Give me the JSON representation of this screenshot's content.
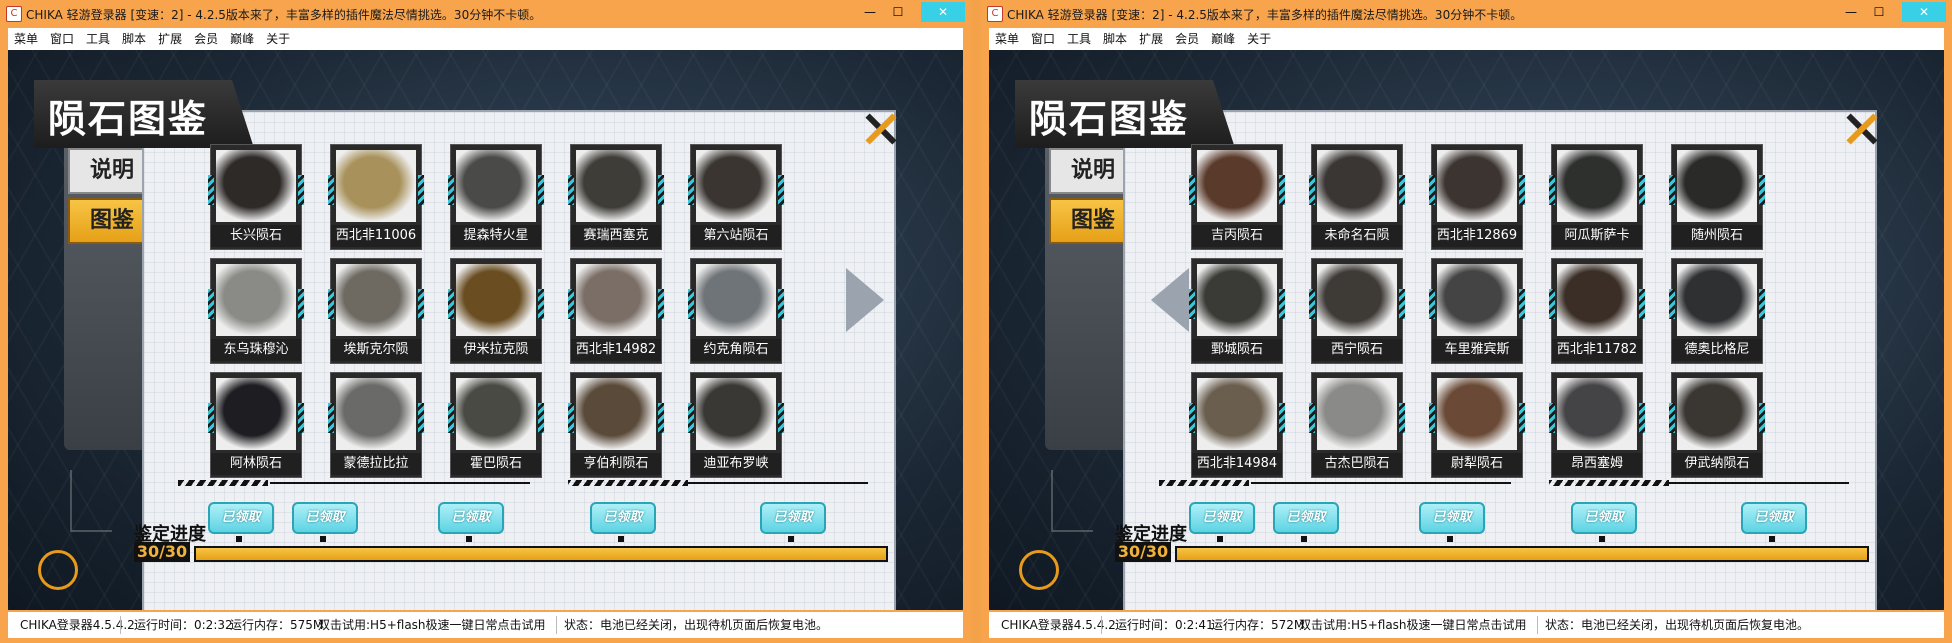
{
  "windows": [
    {
      "title": "CHIKA 轻游登录器 [变速：2] - 4.2.5版本来了，丰富多样的插件魔法尽情挑选。30分钟不卡顿。",
      "menu": [
        "菜单",
        "窗口",
        "工具",
        "脚本",
        "扩展",
        "会员",
        "巅峰",
        "关于"
      ],
      "game": {
        "heading": "陨石图鉴",
        "tabs": [
          "说明",
          "图鉴"
        ],
        "meteorites": [
          {
            "name": "长兴陨石",
            "color": "#2e2a28"
          },
          {
            "name": "西北非11006",
            "color": "#a8915a"
          },
          {
            "name": "提森特火星",
            "color": "#4a4a48"
          },
          {
            "name": "赛瑞西塞克",
            "color": "#3e3d38"
          },
          {
            "name": "第六站陨石",
            "color": "#3a3530"
          },
          {
            "name": "东乌珠穆沁",
            "color": "#8a8a86"
          },
          {
            "name": "埃斯克尔陨",
            "color": "#6e6a62"
          },
          {
            "name": "伊米拉克陨",
            "color": "#6a4e22"
          },
          {
            "name": "西北非14982",
            "color": "#7a6e66"
          },
          {
            "name": "约克角陨石",
            "color": "#6f7478"
          },
          {
            "name": "阿林陨石",
            "color": "#1e1e22"
          },
          {
            "name": "蒙德拉比拉",
            "color": "#6a6a68"
          },
          {
            "name": "霍巴陨石",
            "color": "#4a4a44"
          },
          {
            "name": "亨伯利陨石",
            "color": "#5a4a3a"
          },
          {
            "name": "迪亚布罗峡",
            "color": "#3a3834"
          }
        ],
        "nav": "next",
        "progress_label": "鉴定进度",
        "progress_count": "30/30",
        "progress": 1.0,
        "claimed_labels": [
          "已领取",
          "已领取",
          "已领取",
          "已领取",
          "已领取"
        ]
      },
      "status": {
        "version": "CHIKA登录器4.5.4.2",
        "runtime": "运行时间：0:2:32",
        "memory": "运行内存：575M",
        "hint": "双击试用:H5+flash极速一键日常点击试用",
        "battery": "状态：电池已经关闭，出现待机页面后恢复电池。"
      }
    },
    {
      "title": "CHIKA 轻游登录器 [变速：2] - 4.2.5版本来了，丰富多样的插件魔法尽情挑选。30分钟不卡顿。",
      "menu": [
        "菜单",
        "窗口",
        "工具",
        "脚本",
        "扩展",
        "会员",
        "巅峰",
        "关于"
      ],
      "game": {
        "heading": "陨石图鉴",
        "tabs": [
          "说明",
          "图鉴"
        ],
        "meteorites": [
          {
            "name": "吉丙陨石",
            "color": "#5a3a2a"
          },
          {
            "name": "未命名石陨",
            "color": "#3a3634"
          },
          {
            "name": "西北非12869",
            "color": "#3c3430"
          },
          {
            "name": "阿瓜斯萨卡",
            "color": "#2e302e"
          },
          {
            "name": "随州陨石",
            "color": "#2a2a28"
          },
          {
            "name": "鄄城陨石",
            "color": "#3a3a36"
          },
          {
            "name": "西宁陨石",
            "color": "#3e3a36"
          },
          {
            "name": "车里雅宾斯",
            "color": "#444"
          },
          {
            "name": "西北非11782",
            "color": "#3a2e26"
          },
          {
            "name": "德奥比格尼",
            "color": "#2e3032"
          },
          {
            "name": "西北非14984",
            "color": "#6a5e4e"
          },
          {
            "name": "古杰巴陨石",
            "color": "#8a8a88"
          },
          {
            "name": "尉犁陨石",
            "color": "#6a4a36"
          },
          {
            "name": "昂西塞姆",
            "color": "#444446"
          },
          {
            "name": "伊武纳陨石",
            "color": "#3a3632"
          }
        ],
        "nav": "prev",
        "progress_label": "鉴定进度",
        "progress_count": "30/30",
        "progress": 1.0,
        "claimed_labels": [
          "已领取",
          "已领取",
          "已领取",
          "已领取",
          "已领取"
        ]
      },
      "status": {
        "version": "CHIKA登录器4.5.4.2",
        "runtime": "运行时间：0:2:41",
        "memory": "运行内存：572M",
        "hint": "双击试用:H5+flash极速一键日常点击试用",
        "battery": "状态：电池已经关闭，出现待机页面后恢复电池。"
      }
    }
  ],
  "window_controls": {
    "minimize": "—",
    "maximize": "☐",
    "close": "✕"
  }
}
